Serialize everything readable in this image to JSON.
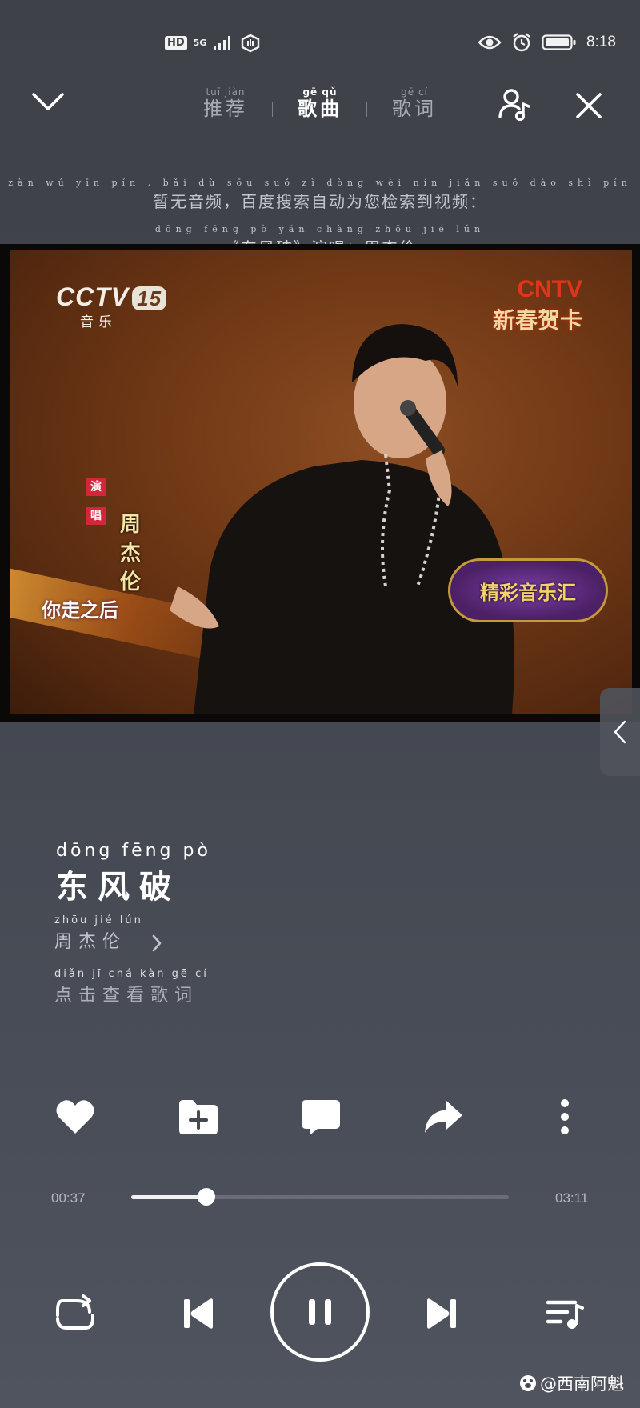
{
  "status_bar": {
    "hd": "HD",
    "network": "5G",
    "time": "8:18"
  },
  "tabs": [
    {
      "pinyin": "tuī jiàn",
      "label": "推荐",
      "active": false
    },
    {
      "pinyin": "gē qǔ",
      "label": "歌曲",
      "active": true
    },
    {
      "pinyin": "gē cí",
      "label": "歌词",
      "active": false
    }
  ],
  "notice": {
    "pinyin": "zàn wú yīn pín , bǎi dù sōu suǒ zì dòng wèi nín jiǎn suǒ dào shì pín",
    "text": "暂无音频，百度搜索自动为您检索到视频：",
    "line2_pinyin": "dōng fēng pò        yǎn chàng zhōu jié lún",
    "line2_text": "《东风破》演唱：周杰伦"
  },
  "video": {
    "channel_logo": "CCTV",
    "channel_number": "15",
    "channel_sub": "音乐",
    "corner_logo": "CNTV",
    "corner_sub": "新春贺卡",
    "singer_label_1": "演",
    "singer_label_2": "唱",
    "singer_name": "周杰伦",
    "subtitle": "你走之后",
    "show_badge": "精彩音乐汇"
  },
  "song": {
    "title_pinyin": "dōng fēng pò",
    "title": "东风破",
    "artist_pinyin": "zhōu jié lún",
    "artist": "周杰伦",
    "lyrics_pinyin": "diǎn jī chá kàn gē cí",
    "lyrics_link": "点击查看歌词"
  },
  "player": {
    "current_time": "00:37",
    "total_time": "03:11",
    "progress": 0.2
  },
  "watermark": "@西南阿魁",
  "colors": {
    "background": "#43464e",
    "accent": "#ffffff",
    "track": "#6a6d76"
  },
  "icons": {
    "back": "chevron-down-icon",
    "voice": "voice-search-icon",
    "close": "close-icon",
    "like": "heart-icon",
    "add": "add-to-folder-icon",
    "comment": "comment-icon",
    "share": "share-icon",
    "more": "more-vertical-icon",
    "repeat": "repeat-icon",
    "prev": "previous-icon",
    "pause": "pause-icon",
    "next": "next-icon",
    "playlist": "playlist-icon"
  }
}
